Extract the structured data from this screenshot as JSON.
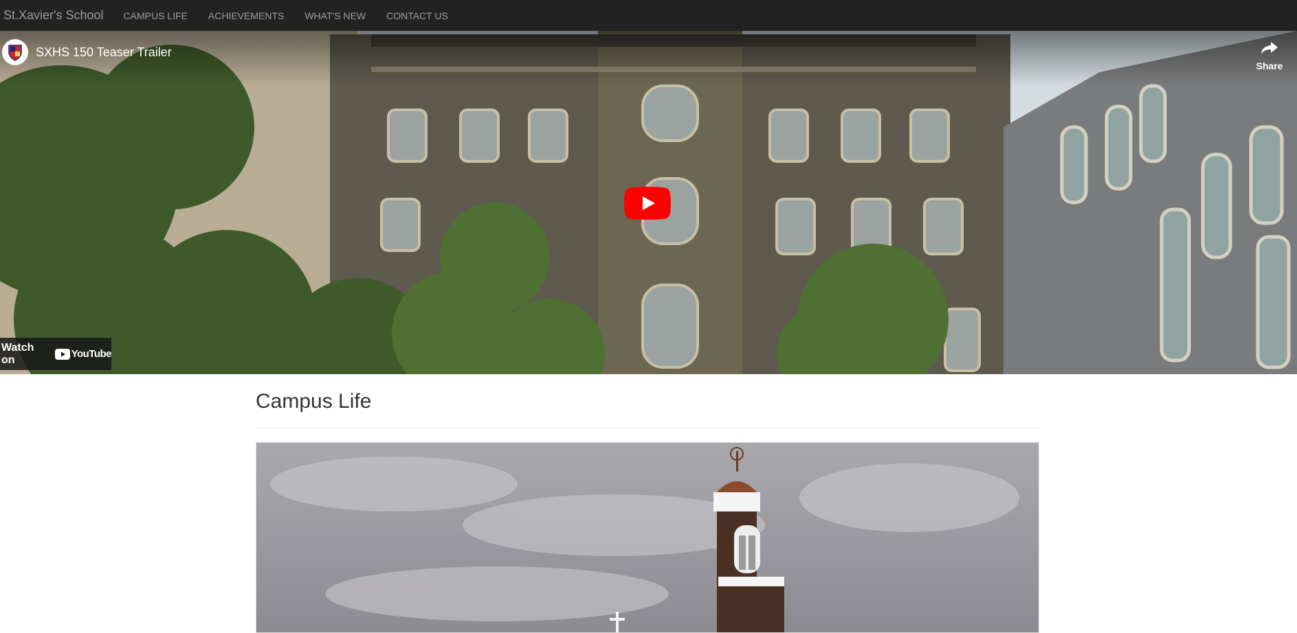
{
  "navbar": {
    "brand": "St.Xavier's School",
    "items": [
      "CAMPUS LIFE",
      "ACHIEVEMENTS",
      "WHAT'S NEW",
      "CONTACT US"
    ]
  },
  "video": {
    "title": "SXHS 150 Teaser Trailer",
    "share_label": "Share",
    "watch_on_label": "Watch on",
    "youtube_label": "YouTube"
  },
  "section": {
    "title": "Campus Life"
  },
  "colors": {
    "navbar_bg": "#222222",
    "nav_text": "#9d9d9d",
    "play_red": "#ff0000"
  },
  "icons": [
    "channel-logo-crest",
    "share-icon",
    "play-icon",
    "youtube-logo-icon"
  ]
}
